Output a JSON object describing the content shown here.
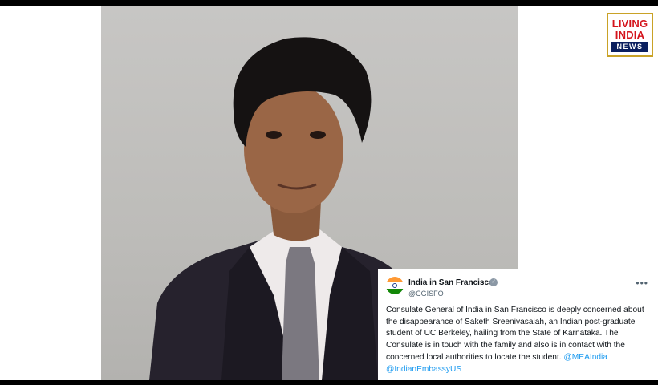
{
  "logo": {
    "line1": "LIVING",
    "line2": "INDIA",
    "line3": "NEWS"
  },
  "tweet": {
    "display_name": "India in San Francisco",
    "handle": "@CGISFO",
    "more_label": "•••",
    "verified_label": "✓",
    "text": "Consulate General of India in San Francisco is deeply concerned about the disappearance of Saketh Sreenivasaiah, an Indian post-graduate student of UC Berkeley, hailing from the State of Karnataka. The Consulate is in touch with the family and also is in contact with the concerned local authorities to locate the student.",
    "mentions": [
      "@MEAIndia",
      "@IndianEmbassyUS"
    ]
  },
  "colors": {
    "background": "#000000",
    "link": "#1d9bf0",
    "logo_red": "#d4141c",
    "logo_blue": "#0b1f5e"
  }
}
